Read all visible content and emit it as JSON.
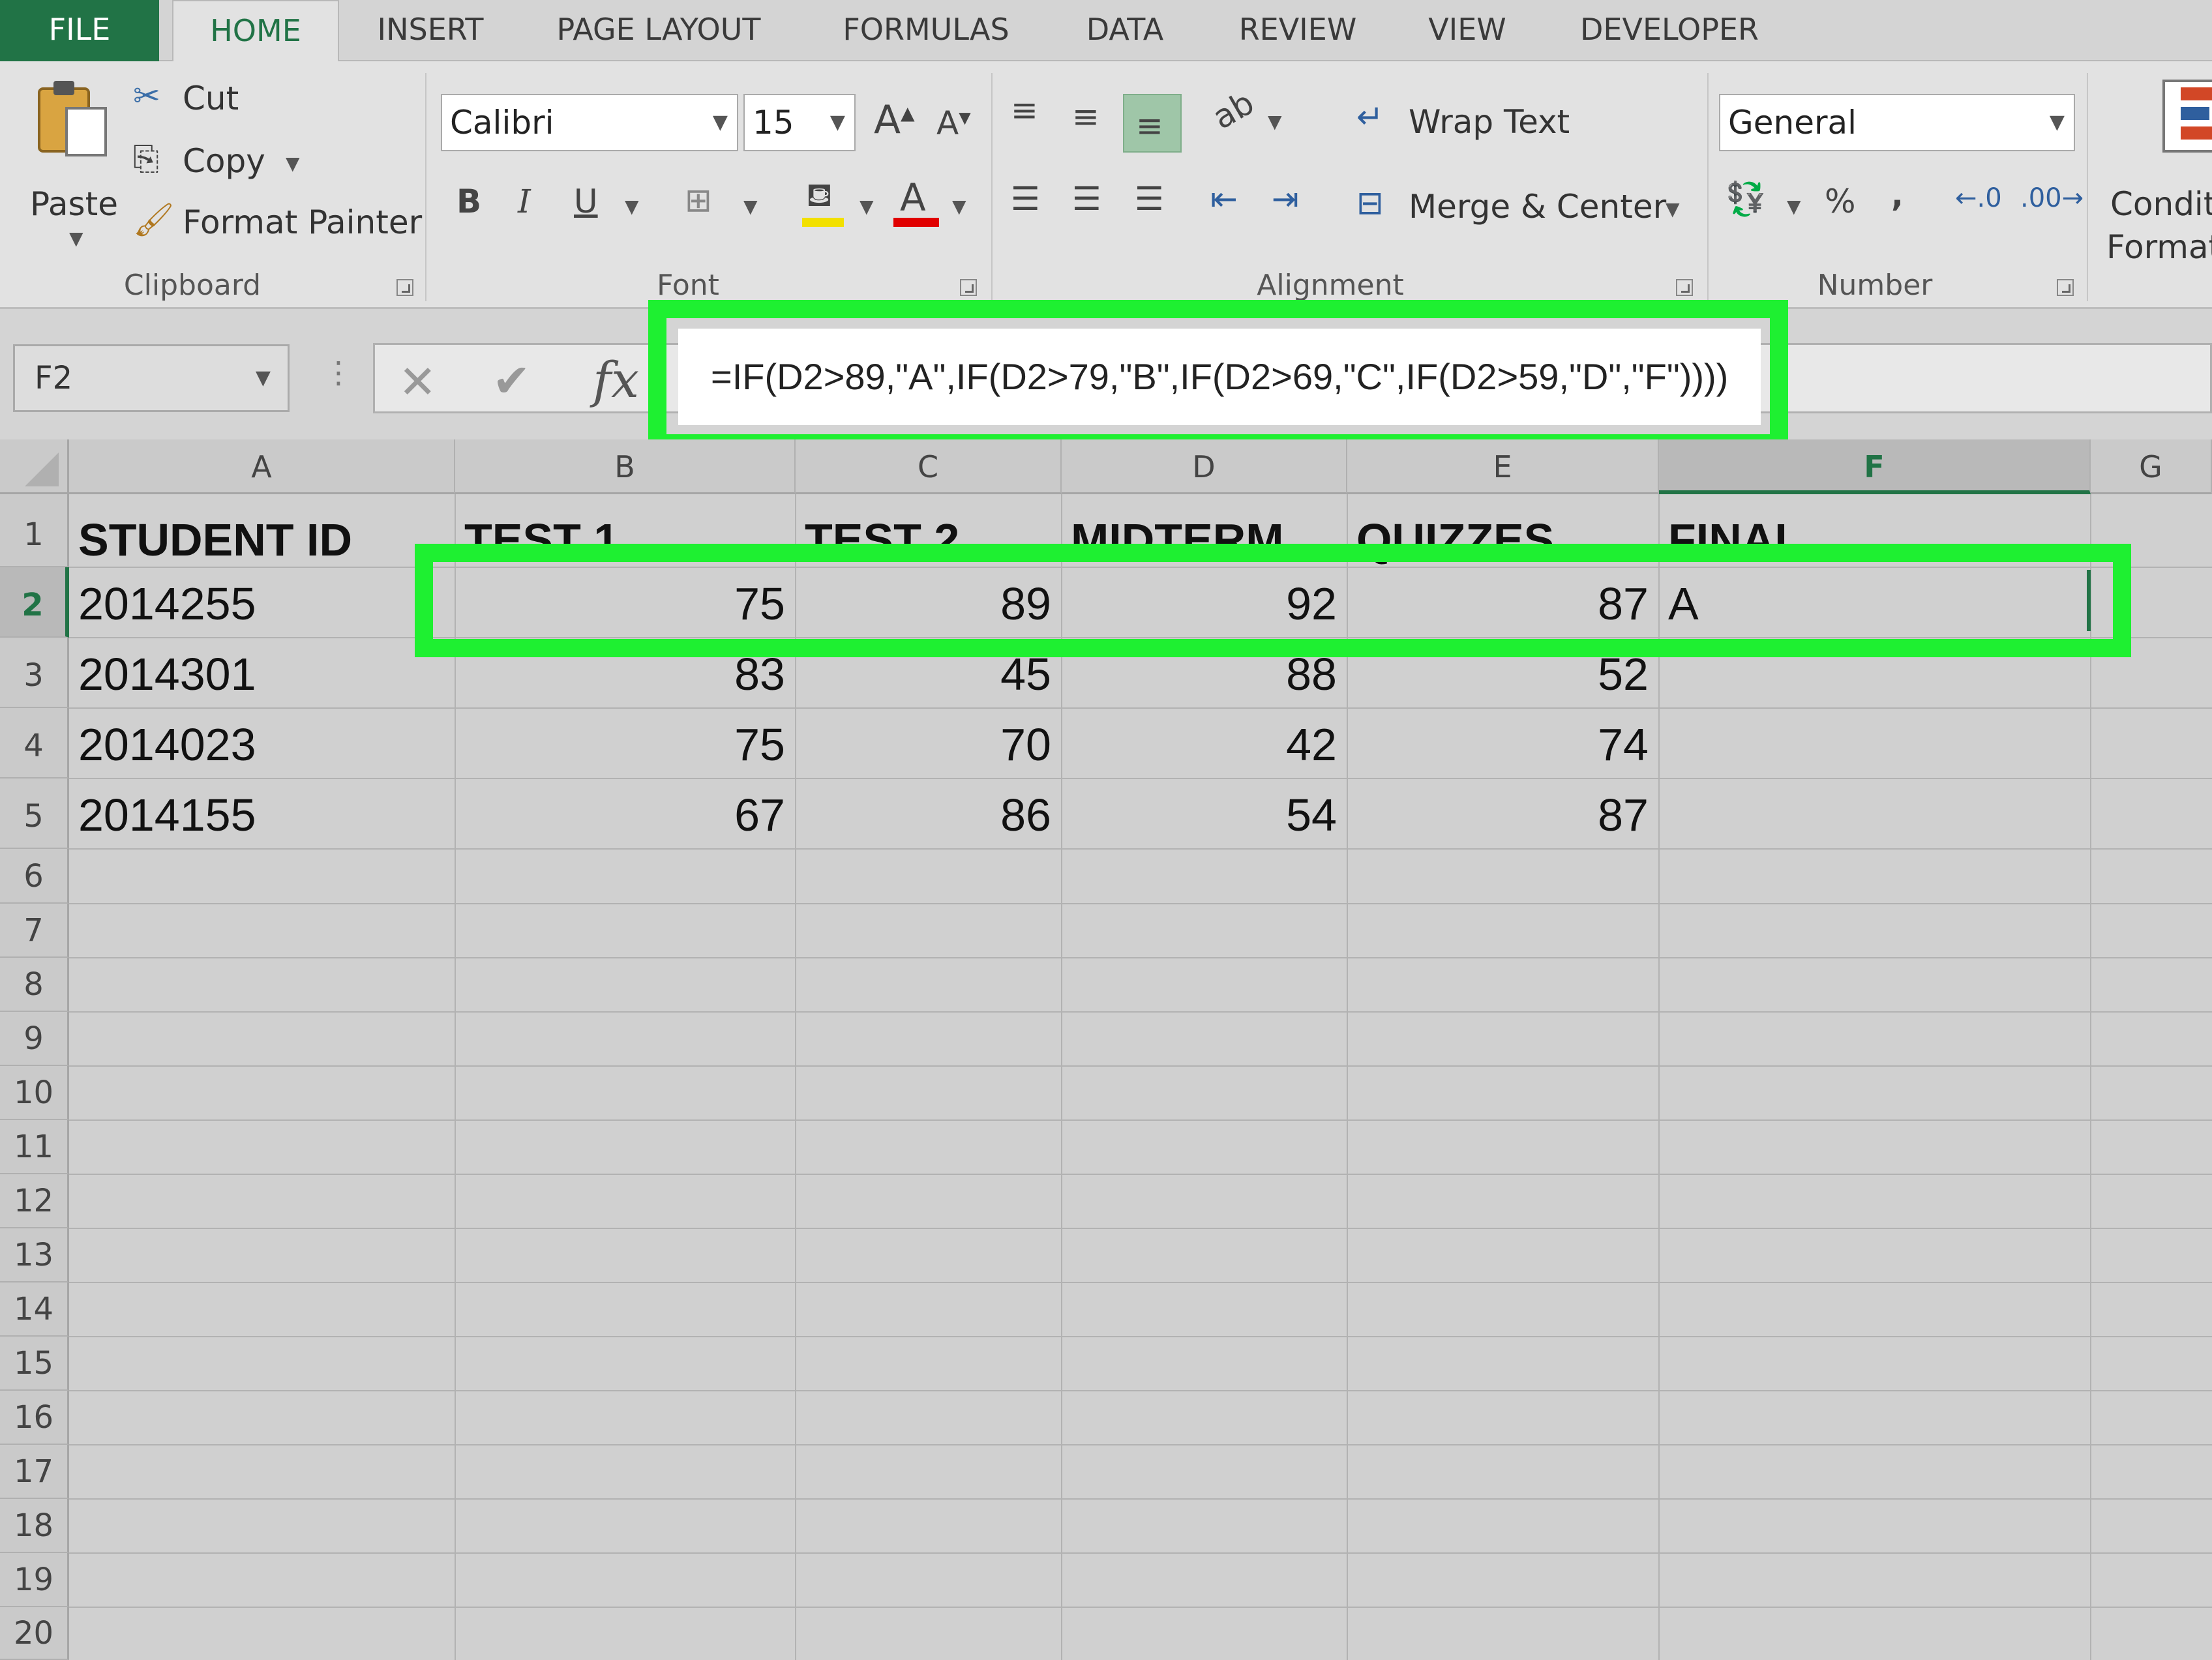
{
  "tabs": [
    "FILE",
    "HOME",
    "INSERT",
    "PAGE LAYOUT",
    "FORMULAS",
    "DATA",
    "REVIEW",
    "VIEW",
    "DEVELOPER"
  ],
  "clipboard": {
    "paste": "Paste",
    "cut": "Cut",
    "copy": "Copy",
    "format_painter": "Format Painter",
    "group_label": "Clipboard"
  },
  "font": {
    "name": "Calibri",
    "size": "15",
    "group_label": "Font"
  },
  "alignment": {
    "wrap_text": "Wrap Text",
    "merge_center": "Merge & Center",
    "group_label": "Alignment"
  },
  "number": {
    "format": "General",
    "group_label": "Number"
  },
  "styles": {
    "conditional_line1": "Condit",
    "conditional_line2": "Format"
  },
  "formula_bar": {
    "name_box": "F2",
    "formula": "=IF(D2>89,\"A\",IF(D2>79,\"B\",IF(D2>69,\"C\",IF(D2>59,\"D\",\"F\"))))"
  },
  "sheet": {
    "columns": [
      "A",
      "B",
      "C",
      "D",
      "E",
      "F",
      "G"
    ],
    "row_numbers": [
      "1",
      "2",
      "3",
      "4",
      "5",
      "6",
      "7",
      "8",
      "9",
      "10",
      "11",
      "12",
      "13",
      "14",
      "15",
      "16",
      "17",
      "18",
      "19",
      "20"
    ],
    "headers": [
      "STUDENT ID",
      "TEST 1",
      "TEST 2",
      "MIDTERM",
      "QUIZZES",
      "FINAL"
    ],
    "rows": [
      {
        "id": "2014255",
        "test1": "75",
        "test2": "89",
        "midterm": "92",
        "quizzes": "87",
        "final": "A"
      },
      {
        "id": "2014301",
        "test1": "83",
        "test2": "45",
        "midterm": "88",
        "quizzes": "52",
        "final": ""
      },
      {
        "id": "2014023",
        "test1": "75",
        "test2": "70",
        "midterm": "42",
        "quizzes": "74",
        "final": ""
      },
      {
        "id": "2014155",
        "test1": "67",
        "test2": "86",
        "midterm": "54",
        "quizzes": "87",
        "final": ""
      }
    ]
  },
  "colors": {
    "excel_green": "#217346",
    "highlight": "#1ef031",
    "font_color_bar": "#e00000",
    "fill_color_bar": "#f2e000"
  }
}
